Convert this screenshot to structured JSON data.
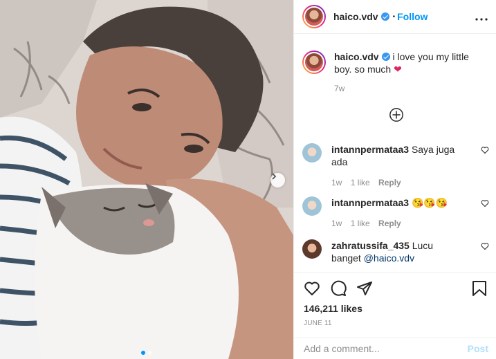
{
  "header": {
    "username": "haico.vdv",
    "verified": true,
    "follow_separator": "•",
    "follow_label": "Follow",
    "more_icon": "more-horizontal-icon"
  },
  "caption": {
    "username": "haico.vdv",
    "text": "i love you my little boy. so much",
    "emoji": "❤",
    "time": "7w"
  },
  "load_more_icon": "plus-circle-icon",
  "comments": [
    {
      "username": "intannpermataa3",
      "text": "Saya juga ada",
      "time": "1w",
      "likes": "1 like",
      "reply": "Reply"
    },
    {
      "username": "intannpermataa3",
      "text": "",
      "emojis": [
        "😘",
        "😘",
        "😘"
      ],
      "time": "1w",
      "likes": "1 like",
      "reply": "Reply"
    },
    {
      "username": "zahratussifa_435",
      "text": "Lucu banget",
      "mention": "@haico.vdv"
    }
  ],
  "actions": {
    "icons": [
      "heart-icon",
      "comment-icon",
      "share-icon",
      "bookmark-icon"
    ],
    "likes": "146,211 likes",
    "date": "JUNE 11"
  },
  "add_comment": {
    "placeholder": "Add a comment...",
    "post_label": "Post"
  },
  "carousel": {
    "count": 2,
    "active_index": 0
  },
  "colors": {
    "accent": "#0095f6",
    "verified": "#3897f0",
    "heart": "#e0245e",
    "muted": "#8e8e8e"
  }
}
